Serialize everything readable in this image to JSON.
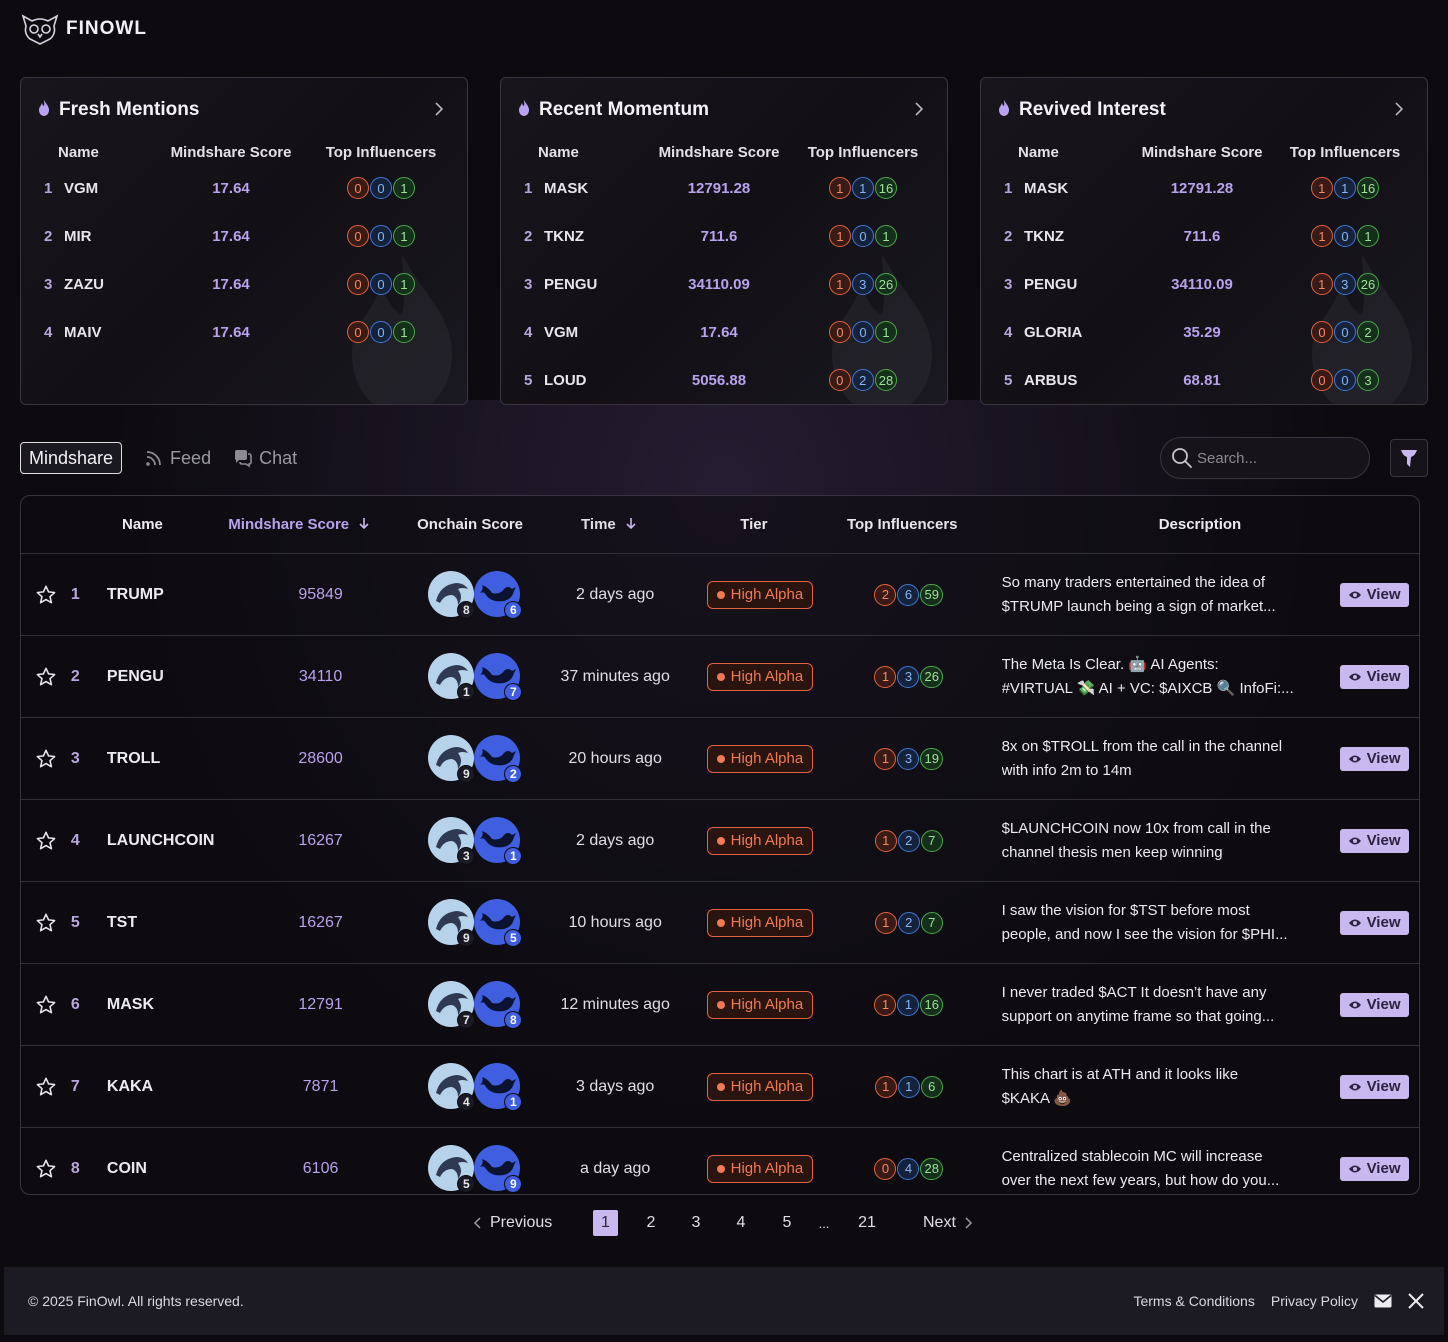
{
  "brand": {
    "name": "FINOWL"
  },
  "cards": [
    {
      "title": "Fresh Mentions",
      "headers": {
        "name": "Name",
        "score": "Mindshare Score",
        "influencers": "Top Influencers"
      },
      "rows": [
        {
          "rank": "1",
          "name": "VGM",
          "score": "17.64",
          "inf": [
            "0",
            "0",
            "1"
          ]
        },
        {
          "rank": "2",
          "name": "MIR",
          "score": "17.64",
          "inf": [
            "0",
            "0",
            "1"
          ]
        },
        {
          "rank": "3",
          "name": "ZAZU",
          "score": "17.64",
          "inf": [
            "0",
            "0",
            "1"
          ]
        },
        {
          "rank": "4",
          "name": "MAIV",
          "score": "17.64",
          "inf": [
            "0",
            "0",
            "1"
          ]
        }
      ]
    },
    {
      "title": "Recent Momentum",
      "headers": {
        "name": "Name",
        "score": "Mindshare Score",
        "influencers": "Top Influencers"
      },
      "rows": [
        {
          "rank": "1",
          "name": "MASK",
          "score": "12791.28",
          "inf": [
            "1",
            "1",
            "16"
          ]
        },
        {
          "rank": "2",
          "name": "TKNZ",
          "score": "711.6",
          "inf": [
            "1",
            "0",
            "1"
          ]
        },
        {
          "rank": "3",
          "name": "PENGU",
          "score": "34110.09",
          "inf": [
            "1",
            "3",
            "26"
          ]
        },
        {
          "rank": "4",
          "name": "VGM",
          "score": "17.64",
          "inf": [
            "0",
            "0",
            "1"
          ]
        },
        {
          "rank": "5",
          "name": "LOUD",
          "score": "5056.88",
          "inf": [
            "0",
            "2",
            "28"
          ]
        }
      ]
    },
    {
      "title": "Revived Interest",
      "headers": {
        "name": "Name",
        "score": "Mindshare Score",
        "influencers": "Top Influencers"
      },
      "rows": [
        {
          "rank": "1",
          "name": "MASK",
          "score": "12791.28",
          "inf": [
            "1",
            "1",
            "16"
          ]
        },
        {
          "rank": "2",
          "name": "TKNZ",
          "score": "711.6",
          "inf": [
            "1",
            "0",
            "1"
          ]
        },
        {
          "rank": "3",
          "name": "PENGU",
          "score": "34110.09",
          "inf": [
            "1",
            "3",
            "26"
          ]
        },
        {
          "rank": "4",
          "name": "GLORIA",
          "score": "35.29",
          "inf": [
            "0",
            "0",
            "2"
          ]
        },
        {
          "rank": "5",
          "name": "ARBUS",
          "score": "68.81",
          "inf": [
            "0",
            "0",
            "3"
          ]
        }
      ]
    }
  ],
  "tabs": [
    {
      "label": "Mindshare",
      "active": true
    },
    {
      "label": "Feed",
      "active": false
    },
    {
      "label": "Chat",
      "active": false
    }
  ],
  "search": {
    "placeholder": "Search..."
  },
  "table": {
    "headers": {
      "name": "Name",
      "mindshare": "Mindshare Score",
      "onchain": "Onchain Score",
      "time": "Time",
      "tier": "Tier",
      "influencers": "Top Influencers",
      "description": "Description"
    },
    "view_label": "View",
    "rows": [
      {
        "rank": "1",
        "name": "TRUMP",
        "mindshare": "95849",
        "oc": [
          "8",
          "6"
        ],
        "time": "2 days ago",
        "tier": "High Alpha",
        "inf": [
          "2",
          "6",
          "59"
        ],
        "desc": [
          "So many traders entertained the idea of",
          "$TRUMP launch being a sign of market..."
        ]
      },
      {
        "rank": "2",
        "name": "PENGU",
        "mindshare": "34110",
        "oc": [
          "1",
          "7"
        ],
        "time": "37 minutes ago",
        "tier": "High Alpha",
        "inf": [
          "1",
          "3",
          "26"
        ],
        "desc": [
          "The Meta Is Clear. 🤖 AI Agents:",
          "#VIRTUAL 💸 AI + VC: $AIXCB 🔍 InfoFi:..."
        ]
      },
      {
        "rank": "3",
        "name": "TROLL",
        "mindshare": "28600",
        "oc": [
          "9",
          "2"
        ],
        "time": "20 hours ago",
        "tier": "High Alpha",
        "inf": [
          "1",
          "3",
          "19"
        ],
        "desc": [
          "8x on $TROLL from the call in the channel",
          "with info 2m to 14m"
        ]
      },
      {
        "rank": "4",
        "name": "LAUNCHCOIN",
        "mindshare": "16267",
        "oc": [
          "3",
          "1"
        ],
        "time": "2 days ago",
        "tier": "High Alpha",
        "inf": [
          "1",
          "2",
          "7"
        ],
        "desc": [
          "$LAUNCHCOIN now 10x from call in the",
          "channel thesis men keep winning"
        ]
      },
      {
        "rank": "5",
        "name": "TST",
        "mindshare": "16267",
        "oc": [
          "9",
          "5"
        ],
        "time": "10 hours ago",
        "tier": "High Alpha",
        "inf": [
          "1",
          "2",
          "7"
        ],
        "desc": [
          "I saw the vision for $TST before most",
          "people, and now I see the vision for $PHI..."
        ]
      },
      {
        "rank": "6",
        "name": "MASK",
        "mindshare": "12791",
        "oc": [
          "7",
          "8"
        ],
        "time": "12 minutes ago",
        "tier": "High Alpha",
        "inf": [
          "1",
          "1",
          "16"
        ],
        "desc": [
          "I never traded $ACT It doesn’t have any",
          "support on anytime frame so that going..."
        ]
      },
      {
        "rank": "7",
        "name": "KAKA",
        "mindshare": "7871",
        "oc": [
          "4",
          "1"
        ],
        "time": "3 days ago",
        "tier": "High Alpha",
        "inf": [
          "1",
          "1",
          "6"
        ],
        "desc": [
          "This chart is at ATH and it looks like",
          "$KAKA 💩"
        ]
      },
      {
        "rank": "8",
        "name": "COIN",
        "mindshare": "6106",
        "oc": [
          "5",
          "9"
        ],
        "time": "a day ago",
        "tier": "High Alpha",
        "inf": [
          "0",
          "4",
          "28"
        ],
        "desc": [
          "Centralized stablecoin MC will increase",
          "over the next few years, but how do you..."
        ]
      }
    ]
  },
  "pagination": {
    "previous": "Previous",
    "next": "Next",
    "pages": [
      "1",
      "2",
      "3",
      "4",
      "5",
      "...",
      "21"
    ],
    "current": "1"
  },
  "footer": {
    "copyright": "© 2025 FinOwl. All rights reserved.",
    "terms": "Terms & Conditions",
    "privacy": "Privacy Policy"
  },
  "colors": {
    "accent": "#c9b8f0",
    "tier": "#e2633e",
    "background": "#0d0b10"
  },
  "icons": [
    "owl-logo-icon",
    "flame-icon",
    "chevron-right-icon",
    "rss-icon",
    "chat-icon",
    "search-icon",
    "filter-icon",
    "star-icon",
    "sort-down-icon",
    "eye-icon",
    "dolphin-icon",
    "whale-icon",
    "mail-icon",
    "x-icon",
    "chevron-left-icon"
  ]
}
